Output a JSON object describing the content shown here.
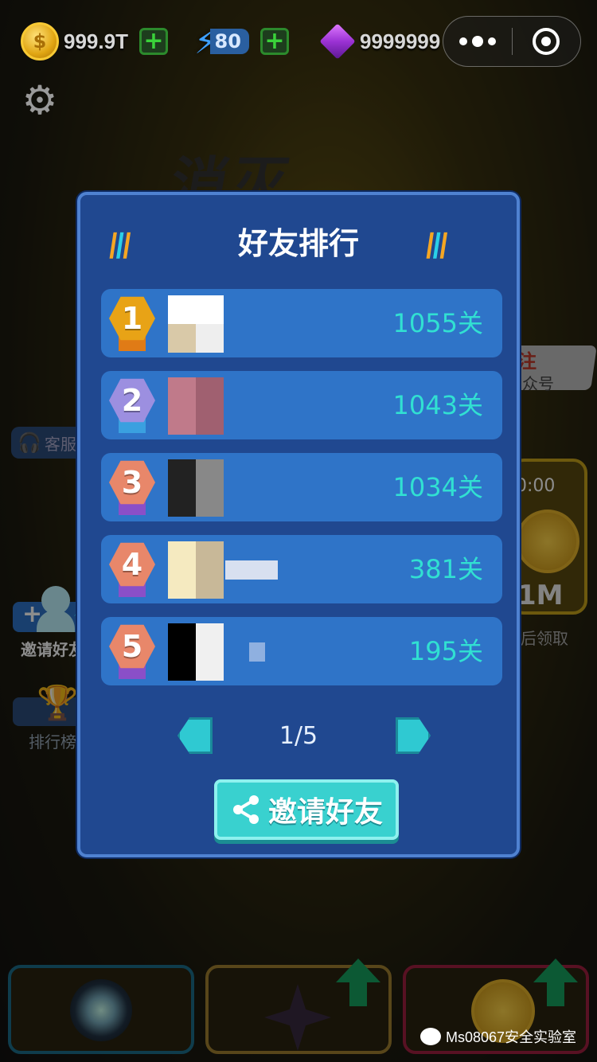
{
  "top_bar": {
    "coins": "999.9T",
    "coin_symbol": "$",
    "energy": "80",
    "gems": "9999999",
    "plus": "+"
  },
  "background": {
    "logo_text": "消灭",
    "customer_service_label": "客服",
    "invite_friends_label": "邀请好友",
    "leaderboard_label": "排行榜",
    "promo_title": "注",
    "promo_sub": "众号",
    "timer_text": "0:00",
    "timer_value": "1M",
    "timer_claim": "后领取"
  },
  "modal": {
    "title": "好友排行",
    "rows": [
      {
        "rank": "1",
        "score": "1055关",
        "badge_color": "#e8a316",
        "ribbon_color": "#e07b16"
      },
      {
        "rank": "2",
        "score": "1043关",
        "badge_color": "#9c8fe0",
        "ribbon_color": "#3aa0e0"
      },
      {
        "rank": "3",
        "score": "1034关",
        "badge_color": "#e8876a",
        "ribbon_color": "#8a4fc8"
      },
      {
        "rank": "4",
        "score": "381关",
        "badge_color": "#e8876a",
        "ribbon_color": "#8a4fc8"
      },
      {
        "rank": "5",
        "score": "195关",
        "badge_color": "#e8876a",
        "ribbon_color": "#8a4fc8"
      }
    ],
    "pager": "1/5",
    "invite_button": "邀请好友"
  },
  "watermark": "Ms08067安全实验室",
  "colors": {
    "modal_bg": "#204890",
    "row_bg": "#2f74c8",
    "score_text": "#31e0d2",
    "button": "#39d1cf"
  },
  "icons": [
    "coin-icon",
    "energy-bolt-icon",
    "gem-icon",
    "more-dots-icon",
    "close-target-icon",
    "settings-gear-icon",
    "share-icon",
    "headset-icon",
    "trophy-icon",
    "arrow-left-icon",
    "arrow-right-icon"
  ]
}
